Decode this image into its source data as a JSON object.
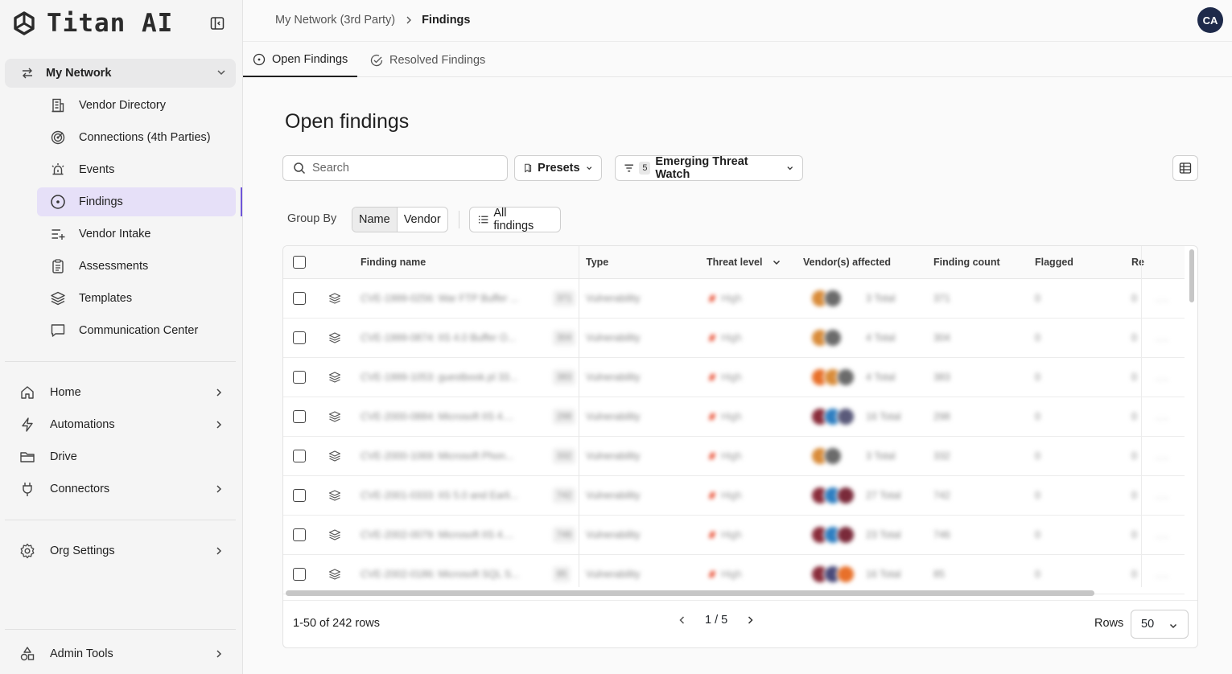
{
  "app": {
    "name": "Titan AI"
  },
  "sidebar": {
    "network_section": "My Network",
    "network_items": [
      {
        "label": "Vendor Directory",
        "icon": "building-icon"
      },
      {
        "label": "Connections (4th Parties)",
        "icon": "target-icon"
      },
      {
        "label": "Events",
        "icon": "alarm-icon"
      },
      {
        "label": "Findings",
        "icon": "circle-dot-icon",
        "active": true
      },
      {
        "label": "Vendor Intake",
        "icon": "list-plus-icon"
      },
      {
        "label": "Assessments",
        "icon": "clipboard-icon"
      },
      {
        "label": "Templates",
        "icon": "layers-icon"
      },
      {
        "label": "Communication Center",
        "icon": "message-icon"
      }
    ],
    "main_items": [
      {
        "label": "Home",
        "icon": "home-icon"
      },
      {
        "label": "Automations",
        "icon": "bolt-icon"
      },
      {
        "label": "Drive",
        "icon": "folder-icon"
      },
      {
        "label": "Connectors",
        "icon": "plug-icon"
      }
    ],
    "org_settings": "Org Settings",
    "admin_tools": "Admin Tools"
  },
  "header": {
    "breadcrumb": [
      "My Network (3rd Party)",
      "Findings"
    ],
    "avatar_initials": "CA"
  },
  "tabs": [
    {
      "label": "Open Findings",
      "active": true
    },
    {
      "label": "Resolved Findings",
      "active": false
    }
  ],
  "main": {
    "title": "Open findings",
    "search_placeholder": "Search",
    "presets_label": "Presets",
    "filter_count": "5",
    "filter_label": "Emerging Threat Watch",
    "group_by_label": "Group By",
    "group_options": [
      "Name",
      "Vendor"
    ],
    "group_selected": "Name",
    "all_findings_label": "All findings"
  },
  "table": {
    "columns": [
      "Finding name",
      "Type",
      "Threat level",
      "Vendor(s) affected",
      "Finding count",
      "Flagged",
      "Re"
    ],
    "rows": [
      {
        "name": "CVE-1999-0256: War FTP Buffer ...",
        "count_pill": "371",
        "type": "Vulnerability",
        "threat": "High",
        "vendors_text": "3 Total",
        "finding_count": "371",
        "flagged": "0",
        "re": "0",
        "avatars": [
          "#d98c3a",
          "#6b6b6b"
        ]
      },
      {
        "name": "CVE-1999-0874: IIS 4.0 Buffer O...",
        "count_pill": "304",
        "type": "Vulnerability",
        "threat": "High",
        "vendors_text": "4 Total",
        "finding_count": "304",
        "flagged": "0",
        "re": "0",
        "avatars": [
          "#d98c3a",
          "#6b6b6b"
        ]
      },
      {
        "name": "CVE-1999-1053: guestbook.pl 33...",
        "count_pill": "383",
        "type": "Vulnerability",
        "threat": "High",
        "vendors_text": "4 Total",
        "finding_count": "383",
        "flagged": "0",
        "re": "0",
        "avatars": [
          "#e8702a",
          "#d98c3a",
          "#6b6b6b"
        ]
      },
      {
        "name": "CVE-2000-0884: Microsoft IIS 4....",
        "count_pill": "298",
        "type": "Vulnerability",
        "threat": "High",
        "vendors_text": "16 Total",
        "finding_count": "298",
        "flagged": "0",
        "re": "0",
        "avatars": [
          "#8a2d3b",
          "#2f7fc1",
          "#5a5a7a"
        ]
      },
      {
        "name": "CVE-2000-1069: Microsoft Phon...",
        "count_pill": "332",
        "type": "Vulnerability",
        "threat": "High",
        "vendors_text": "3 Total",
        "finding_count": "332",
        "flagged": "0",
        "re": "0",
        "avatars": [
          "#d98c3a",
          "#6b6b6b"
        ]
      },
      {
        "name": "CVE-2001-0333: IIS 5.0 and Earli...",
        "count_pill": "742",
        "type": "Vulnerability",
        "threat": "High",
        "vendors_text": "27 Total",
        "finding_count": "742",
        "flagged": "0",
        "re": "0",
        "avatars": [
          "#8a2d3b",
          "#2f7fc1",
          "#7a2a3a"
        ]
      },
      {
        "name": "CVE-2002-0079: Microsoft IIS 4....",
        "count_pill": "746",
        "type": "Vulnerability",
        "threat": "High",
        "vendors_text": "23 Total",
        "finding_count": "746",
        "flagged": "0",
        "re": "0",
        "avatars": [
          "#8a2d3b",
          "#2f7fc1",
          "#7a2a3a"
        ]
      },
      {
        "name": "CVE-2002-0186: Microsoft SQL S...",
        "count_pill": "85",
        "type": "Vulnerability",
        "threat": "High",
        "vendors_text": "16 Total",
        "finding_count": "85",
        "flagged": "0",
        "re": "0",
        "avatars": [
          "#8a2d3b",
          "#4a4a7a",
          "#e8702a"
        ]
      }
    ]
  },
  "footer": {
    "rows_info": "1-50 of 242 rows",
    "page": "1 / 5",
    "rows_label": "Rows",
    "rows_value": "50"
  },
  "colors": {
    "accent": "#6f56d9",
    "active_bg": "#e6e0f8",
    "threat_high": "#e8543a"
  }
}
